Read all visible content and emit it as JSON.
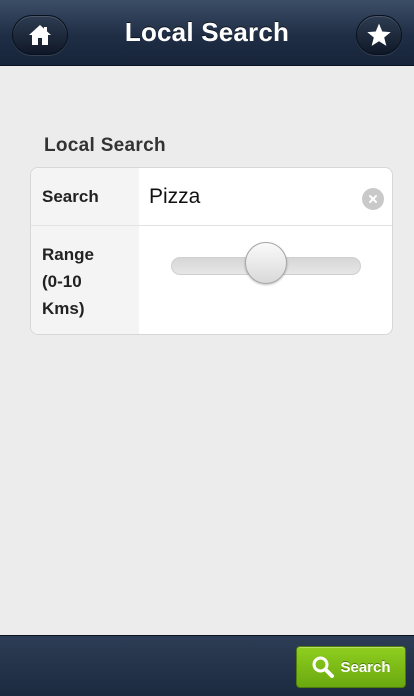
{
  "header": {
    "title": "Local Search",
    "home_icon": "home-icon",
    "favorite_icon": "star-icon"
  },
  "form": {
    "section_title": "Local Search",
    "search": {
      "label": "Search",
      "value": "Pizza",
      "clear_icon": "clear-icon"
    },
    "range": {
      "label_line1": "Range",
      "label_line2": "(0-10",
      "label_line3": "Kms)",
      "min": 0,
      "max": 10,
      "value": 5
    }
  },
  "footer": {
    "search_button_label": "Search",
    "search_button_icon": "search-icon",
    "search_button_color": "#7dbe1a"
  },
  "colors": {
    "header_bg": "#1f2e45",
    "page_bg": "#ececec"
  }
}
